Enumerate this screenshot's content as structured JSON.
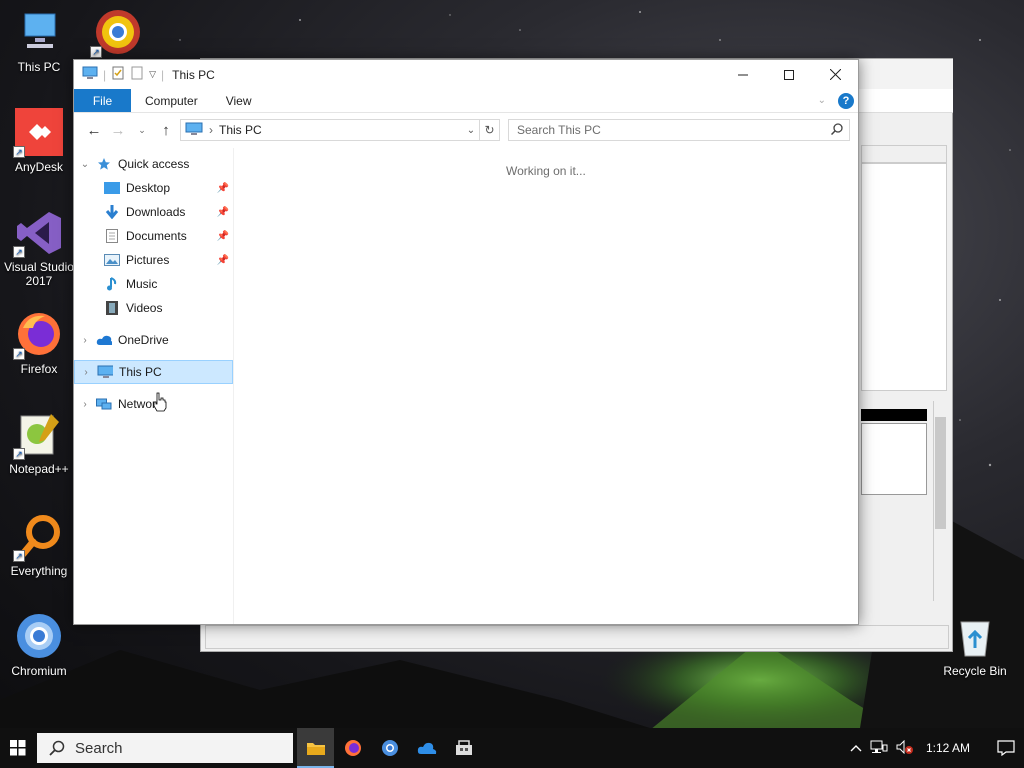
{
  "desktop": {
    "icons": [
      {
        "label": "This PC"
      },
      {
        "label": "AnyDesk"
      },
      {
        "label": "Visual Studio 2017"
      },
      {
        "label": "Firefox"
      },
      {
        "label": "Notepad++"
      },
      {
        "label": "Everything"
      },
      {
        "label": "Chromium"
      },
      {
        "label": "Recycle Bin"
      }
    ]
  },
  "window": {
    "title": "This PC",
    "ribbon": {
      "file": "File",
      "computer": "Computer",
      "view": "View",
      "help": "?"
    },
    "address": {
      "location": "This PC"
    },
    "search": {
      "placeholder": "Search This PC"
    },
    "status_message": "Working on it...",
    "nav": {
      "quick_access": "Quick access",
      "pinned": [
        {
          "label": "Desktop",
          "pinned": true
        },
        {
          "label": "Downloads",
          "pinned": true
        },
        {
          "label": "Documents",
          "pinned": true
        },
        {
          "label": "Pictures",
          "pinned": true
        },
        {
          "label": "Music",
          "pinned": false
        },
        {
          "label": "Videos",
          "pinned": false
        }
      ],
      "onedrive": "OneDrive",
      "this_pc": "This PC",
      "network": "Network"
    }
  },
  "taskbar": {
    "search_label": "Search",
    "clock": "1:12 AM",
    "apps": [
      "file-explorer",
      "firefox",
      "chromium",
      "onedrive",
      "store"
    ]
  },
  "colors": {
    "accent": "#1979ca",
    "selection": "#cce8ff",
    "taskbar": "#101010"
  }
}
